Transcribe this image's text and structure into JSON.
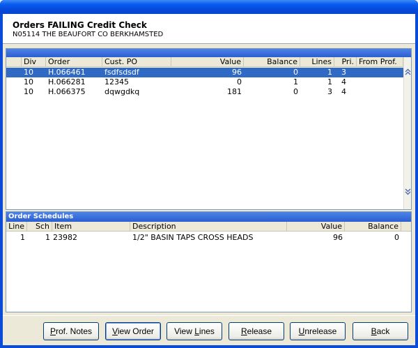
{
  "header": {
    "title": "Orders FAILING Credit Check",
    "subtitle": "N05114 THE BEAUFORT CO BERKHAMSTED"
  },
  "orders": {
    "columns": [
      "Div",
      "Order",
      "Cust. PO",
      "Value",
      "Balance",
      "Lines",
      "Pri.",
      "From Prof."
    ],
    "rows": [
      {
        "div": "10",
        "order": "H.066461",
        "cust_po": "fsdfsdsdf",
        "value": "96",
        "balance": "0",
        "lines": "1",
        "pri": "3",
        "from_prof": ""
      },
      {
        "div": "10",
        "order": "H.066281",
        "cust_po": "12345",
        "value": "0",
        "balance": "1",
        "lines": "1",
        "pri": "4",
        "from_prof": ""
      },
      {
        "div": "10",
        "order": "H.066375",
        "cust_po": "dqwgdkq",
        "value": "181",
        "balance": "0",
        "lines": "3",
        "pri": "4",
        "from_prof": ""
      }
    ],
    "selected_row": 0,
    "scroll_up_icon": "double-chevron-up-icon",
    "scroll_down_icon": "double-chevron-down-icon"
  },
  "schedules": {
    "title": "Order Schedules",
    "columns": [
      "Line",
      "Sch",
      "Item",
      "Description",
      "Value",
      "Balance"
    ],
    "rows": [
      {
        "line": "1",
        "sch": "1",
        "item": "23982",
        "description": "1/2\" BASIN TAPS CROSS HEADS",
        "value": "96",
        "balance": "0"
      }
    ]
  },
  "buttons": {
    "prof_notes": {
      "pre": "",
      "ul": "P",
      "post": "rof. Notes"
    },
    "view_order": {
      "pre": "",
      "ul": "V",
      "post": "iew Order"
    },
    "view_lines": {
      "pre": "View ",
      "ul": "L",
      "post": "ines"
    },
    "release": {
      "pre": "",
      "ul": "R",
      "post": "elease"
    },
    "unrelease": {
      "pre": "",
      "ul": "U",
      "post": "nrelease"
    },
    "back": {
      "pre": "",
      "ul": "B",
      "post": "ack"
    }
  },
  "colors": {
    "title_bar": "#0a4cd8",
    "selection": "#316ac5",
    "band": "#2b5fd0"
  }
}
